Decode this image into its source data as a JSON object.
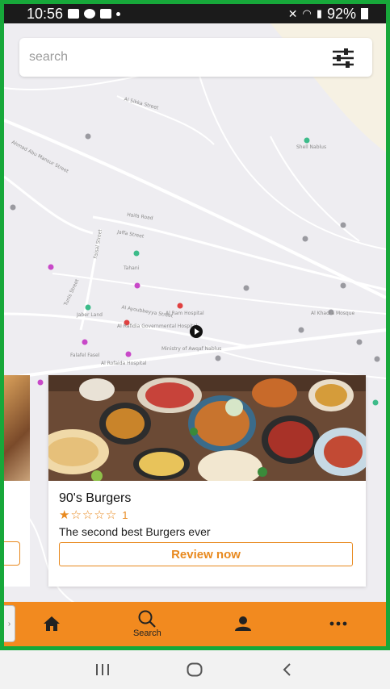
{
  "status_bar": {
    "time": "10:56",
    "battery": "92%"
  },
  "search": {
    "placeholder": "search"
  },
  "map": {
    "streets": [
      "Al Sikka Street",
      "Haifa Road",
      "Jaffa Street",
      "Faisal Street",
      "Tunis Street",
      "Al Ayoubbeyya Street",
      "Ahmad Abu Mansur Street"
    ],
    "places": [
      "Al Rafidia Governmental Hospital",
      "Al Ram Hospital",
      "Jaber Land",
      "Falafel Fasel",
      "Tahani",
      "Ministry of Awqaf Nablus",
      "Al Rofaida Hospital",
      "Al Khadra Mosque",
      "Shell Nablus"
    ]
  },
  "card": {
    "title": "90's  Burgers",
    "rating_value": 1,
    "rating_max": 5,
    "rating_count": "1",
    "description": "The second best Burgers ever",
    "button_label": "Review now"
  },
  "bottom_nav": {
    "items": [
      {
        "label": "",
        "icon": "home-icon"
      },
      {
        "label": "Search",
        "icon": "search-icon"
      },
      {
        "label": "",
        "icon": "profile-icon"
      },
      {
        "label": "",
        "icon": "more-icon"
      }
    ]
  },
  "colors": {
    "accent": "#f28a1f",
    "accent_text": "#e8891e",
    "frame": "#17a83a"
  }
}
